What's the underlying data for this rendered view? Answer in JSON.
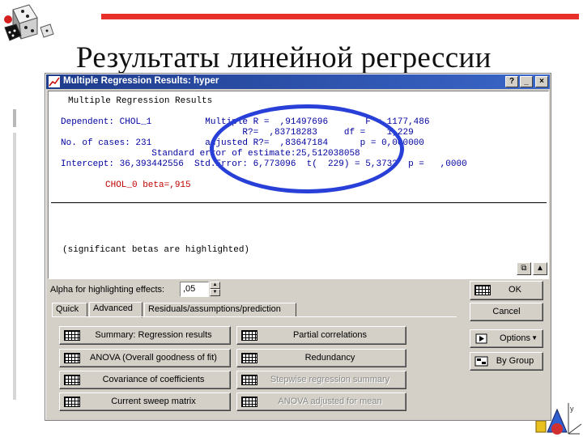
{
  "slide": {
    "title": "Результаты линейной регрессии"
  },
  "window": {
    "title": "Multiple Regression Results: hyper",
    "help_btn": "?",
    "min_btn": "_",
    "close_btn": "×"
  },
  "results": {
    "heading": "Multiple Regression Results",
    "line_dependent": "Dependent: CHOL_1          Multiple R =  ,91497696       F = 1177,486",
    "line_r2": "                                  R?=  ,83718283     df =    1,229",
    "line_cases": "No. of cases: 231          adjusted R?=  ,83647184      p = 0,000000",
    "line_stderr": "                 Standard error of estimate:25,512038058",
    "line_intercept": "Intercept: 36,393442556  Std.Error: 6,773096  t(  229) = 5,3732  p =   ,0000",
    "beta_line": "CHOL_0 beta=,915",
    "footer_note": "(significant betas are highlighted)"
  },
  "controls": {
    "alpha_label": "Alpha for highlighting effects:",
    "alpha_value": ",05",
    "tabs": [
      "Quick",
      "Advanced",
      "Residuals/assumptions/prediction"
    ],
    "buttons_left": [
      "Summary:  Regression results",
      "ANOVA (Overall goodness of fit)",
      "Covariance of coefficients",
      "Current sweep matrix"
    ],
    "buttons_mid": [
      "Partial correlations",
      "Redundancy",
      "Stepwise regression summary",
      "ANOVA adjusted for mean"
    ],
    "ok": "OK",
    "cancel": "Cancel",
    "options": "Options",
    "by_group": "By Group"
  }
}
